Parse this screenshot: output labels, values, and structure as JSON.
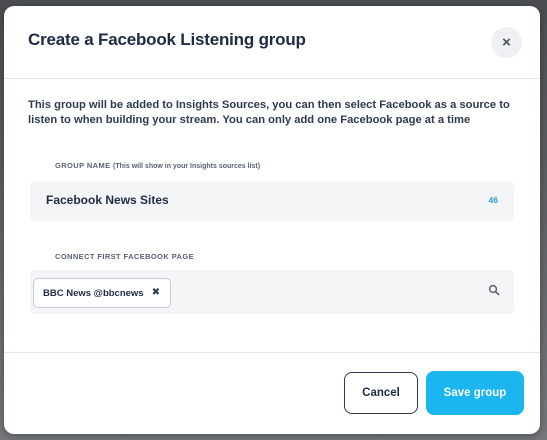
{
  "modal": {
    "title": "Create a Facebook Listening group",
    "close_glyph": "×",
    "intro": "This group will be added to Insights Sources, you can then select Facebook as a source to listen to when building your stream. You can only add one Facebook page at a time"
  },
  "group_name": {
    "label": "GROUP NAME",
    "hint": "(This will show in your Insights sources list)",
    "value": "Facebook News Sites",
    "counter": "46"
  },
  "connect_page": {
    "label": "CONNECT FIRST FACEBOOK PAGE",
    "chip_label": "BBC News @bbcnews",
    "chip_remove_glyph": "✖",
    "search_icon": "search-icon"
  },
  "footer": {
    "cancel_label": "Cancel",
    "save_label": "Save group"
  },
  "colors": {
    "accent": "#1bb5ef",
    "title_text": "#1f2a44",
    "counter_text": "#2a9fd8"
  }
}
